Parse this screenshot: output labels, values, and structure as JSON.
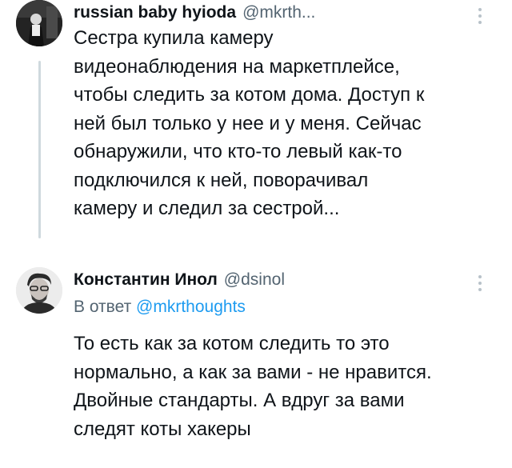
{
  "tweets": [
    {
      "author_name": "russian baby hyioda",
      "author_handle": "@mkrth...",
      "avatar_icon": "user-avatar-dark-icon",
      "more_icon": "more-options-icon",
      "text_lines": [
        "Сестра купила камеру",
        "видеонаблюдения на маркетплейсе,",
        "чтобы следить за котом дома. Доступ к",
        "ней был только у нее и у меня. Сейчас",
        "обнаружили, что кто-то левый как-то",
        "подключился к ней, поворачивал",
        "камеру и следил за сестрой..."
      ]
    },
    {
      "author_name": "Константин Инол",
      "author_handle": "@dsinol",
      "avatar_icon": "user-avatar-photo-icon",
      "more_icon": "more-options-icon",
      "reply_prefix": "В ответ",
      "reply_mention": "@mkrthoughts",
      "text_lines": [
        "То есть как за котом следить то это",
        "нормально, а как за вами - не нравится.",
        "Двойные стандарты. А вдруг за вами",
        "следят коты хакеры"
      ]
    }
  ],
  "colors": {
    "text": "#0f1419",
    "secondary": "#536471",
    "link": "#1d9bf0",
    "thread_line": "#cfd9de"
  }
}
